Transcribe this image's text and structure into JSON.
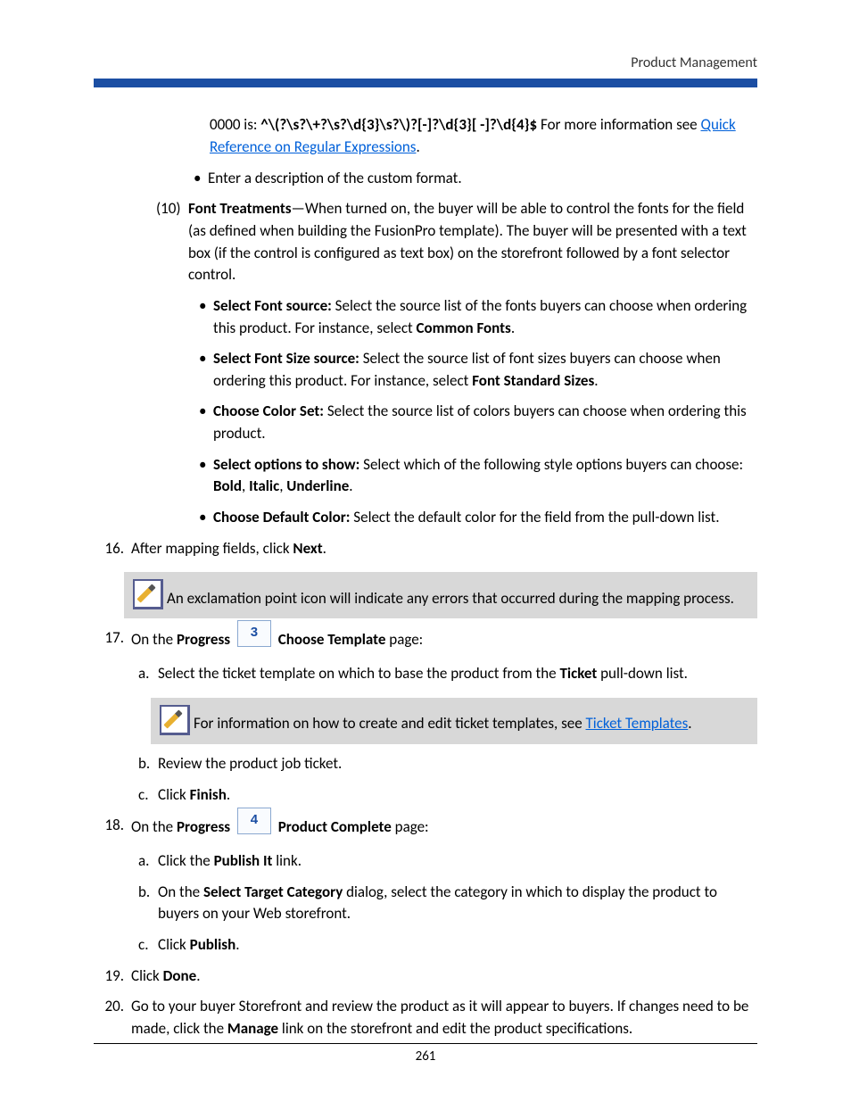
{
  "header": {
    "section": "Product Management"
  },
  "content": {
    "regex_prefix": "0000 is: ",
    "regex_code": "^\\(?\\s?\\+?\\s?\\d{3}\\s?\\)?[-]?\\d{3}[ -]?\\d{4}$",
    "regex_suffix": " For more information see ",
    "regex_link": "Quick Reference on Regular Expressions",
    "regex_period": ".",
    "enter_desc": "Enter a description of the custom format.",
    "font_treat_num": "(10)",
    "font_treat_label": "Font Treatments",
    "font_treat_desc": "—When turned on, the buyer will be able to control the fonts for the field (as defined when building the FusionPro template). The buyer will be presented with a text box (if the control is configured as text box) on the storefront followed by a font selector control.",
    "ft_b1_label": "Select Font source:",
    "ft_b1_text1": " Select the source list of the fonts buyers can choose when ordering this product. For instance, select ",
    "ft_b1_bold": "Common Fonts",
    "ft_b1_text2": ".",
    "ft_b2_label": "Select Font Size source:",
    "ft_b2_text1": " Select the source list of font sizes buyers can choose when ordering this product. For instance, select ",
    "ft_b2_bold": "Font Standard Sizes",
    "ft_b2_text2": ".",
    "ft_b3_label": "Choose Color Set:",
    "ft_b3_text": " Select the source list of colors buyers can choose when ordering this product.",
    "ft_b4_label": "Select options to show:",
    "ft_b4_text1": " Select which of the following style options buyers can choose: ",
    "ft_b4_bold1": "Bold",
    "ft_b4_sep1": ", ",
    "ft_b4_bold2": "Italic",
    "ft_b4_sep2": ", ",
    "ft_b4_bold3": "Underline",
    "ft_b4_text2": ".",
    "ft_b5_label": "Choose Default Color:",
    "ft_b5_text": " Select the default color for the field from the pull-down list.",
    "s16_num": "16.",
    "s16_text1": "After mapping fields, click ",
    "s16_bold": "Next",
    "s16_text2": ".",
    "note1": "An exclamation point icon will indicate any errors that occurred during the mapping process.",
    "s17_num": "17.",
    "s17_text1": "On the ",
    "s17_bold1": "Progress",
    "s17_badge": "3",
    "s17_bold2": "Choose Template",
    "s17_text2": " page:",
    "s17a_num": "a.",
    "s17a_text1": "Select the ticket template on which to base the product from the ",
    "s17a_bold": "Ticket",
    "s17a_text2": " pull-down list.",
    "note2_text1": "For information on how to create and edit ticket templates, see ",
    "note2_link": "Ticket Templates",
    "note2_text2": ".",
    "s17b_num": "b.",
    "s17b_text": "Review the product job ticket.",
    "s17c_num": "c.",
    "s17c_text1": "Click ",
    "s17c_bold": "Finish",
    "s17c_text2": ".",
    "s18_num": "18.",
    "s18_text1": "On the ",
    "s18_bold1": "Progress",
    "s18_badge": "4",
    "s18_bold2": "Product Complete",
    "s18_text2": " page:",
    "s18a_num": "a.",
    "s18a_text1": "Click the ",
    "s18a_bold": "Publish It",
    "s18a_text2": " link.",
    "s18b_num": "b.",
    "s18b_text1": "On the ",
    "s18b_bold": "Select Target Category",
    "s18b_text2": " dialog, select the category in which to display the product to buyers on your Web storefront.",
    "s18c_num": "c.",
    "s18c_text1": "Click ",
    "s18c_bold": "Publish",
    "s18c_text2": ".",
    "s19_num": "19.",
    "s19_text1": "Click ",
    "s19_bold": "Done",
    "s19_text2": ".",
    "s20_num": "20.",
    "s20_text1": "Go to your buyer Storefront and review the product as it will appear to buyers. If changes need to be made, click the ",
    "s20_bold": "Manage",
    "s20_text2": " link on the storefront and edit the product specifications."
  },
  "footer": {
    "page_num": "261"
  }
}
